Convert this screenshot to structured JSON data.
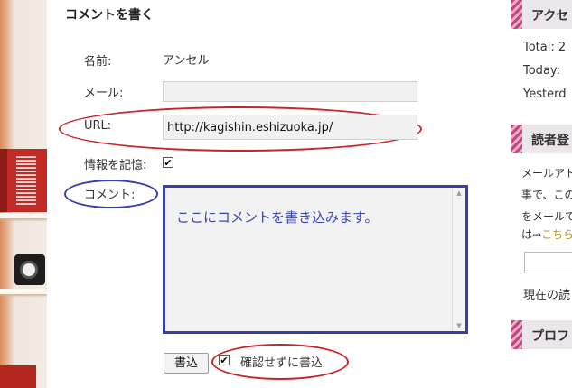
{
  "form": {
    "title": "コメントを書く",
    "name_label": "名前:",
    "name_value": "アンセル",
    "mail_label": "メール:",
    "mail_value": "",
    "url_label": "URL:",
    "url_value": "http://kagishin.eshizuoka.jp/",
    "remember_label": "情報を記憶:",
    "remember_checked": true,
    "comment_label": "コメント:",
    "comment_text": "ここにコメントを書き込みます。",
    "submit_label": "書込",
    "no_confirm_label": "確認せずに書込",
    "no_confirm_checked": true,
    "check_glyph": "✔"
  },
  "sidebar": {
    "access_title": "アクセ",
    "total_label": "Total: 2",
    "today_label": "Today: ",
    "yesterday_label": "Yesterd",
    "reader_title": "読者登",
    "reader_line1": "メールアト",
    "reader_line2": "事で、この",
    "reader_line3": "をメールで",
    "reader_line4_prefix": "は→",
    "reader_line4_link": "こちら",
    "reader_status": "現在の読",
    "profile_title": "プロフ"
  },
  "colors": {
    "annotation_red": "#c8242b",
    "annotation_blue": "#3a3fa8",
    "accent_pink": "#c3467e"
  }
}
